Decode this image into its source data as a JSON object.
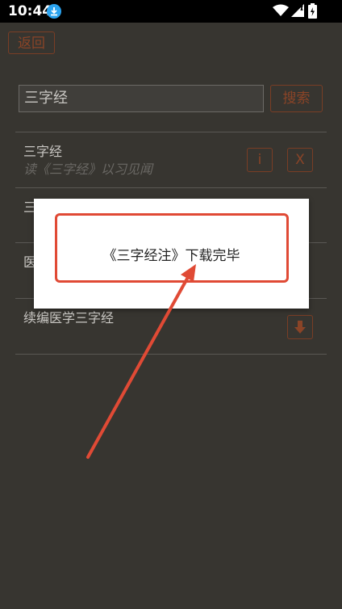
{
  "status_bar": {
    "time": "10:44",
    "icons": [
      "download-icon",
      "wifi-icon",
      "signal-icon",
      "battery-icon"
    ]
  },
  "app": {
    "back_label": "返回",
    "search": {
      "value": "三字经"
    },
    "search_label": "搜索",
    "results": [
      {
        "title": "三字经",
        "subtitle": "读《三字经》以习见闻",
        "info_label": "i",
        "delete_label": "X"
      },
      {
        "title": "三字经注",
        "subtitle": ""
      },
      {
        "title": "医学三字经",
        "subtitle": ""
      },
      {
        "title": "续编医学三字经",
        "subtitle": "",
        "download_icon": "download-arrow-icon"
      }
    ]
  },
  "toast": {
    "message": "《三字经注》下载完毕"
  },
  "colors": {
    "accent": "#e04a35",
    "dim_background": "#373530",
    "button_text": "#8a4427"
  }
}
